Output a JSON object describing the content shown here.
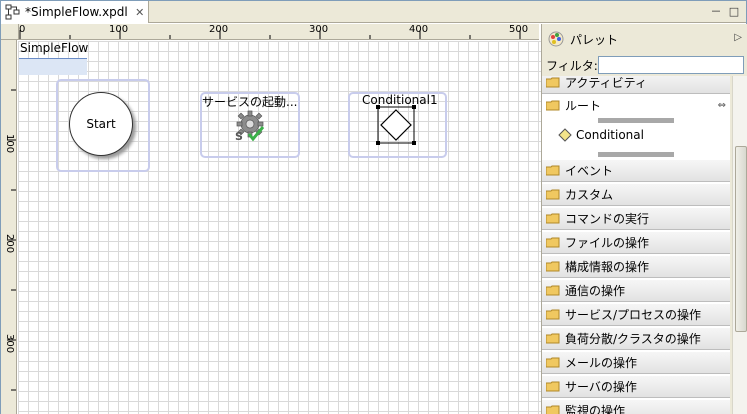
{
  "tab": {
    "title": "*SimpleFlow.xpdl",
    "close_icon": "close-icon"
  },
  "window_controls": {
    "minimize": "－",
    "maximize": "□"
  },
  "ruler": {
    "top_labels": [
      "0",
      "100",
      "200",
      "300",
      "400",
      "500"
    ],
    "left_labels": [
      "100",
      "200",
      "300"
    ]
  },
  "canvas": {
    "pool_name": "SimpleFlow",
    "nodes": {
      "start": {
        "label": "Start"
      },
      "service": {
        "label": "サービスの起動..."
      },
      "conditional": {
        "label": "Conditional1"
      }
    }
  },
  "palette": {
    "title": "パレット",
    "filter_label": "フィルタ:",
    "filter_value": "",
    "items": [
      {
        "label": "アクティビティ"
      },
      {
        "label": "ルート"
      },
      {
        "label": "Conditional"
      },
      {
        "label": "イベント"
      },
      {
        "label": "カスタム"
      },
      {
        "label": "コマンドの実行"
      },
      {
        "label": "ファイルの操作"
      },
      {
        "label": "構成情報の操作"
      },
      {
        "label": "通信の操作"
      },
      {
        "label": "サービス/プロセスの操作"
      },
      {
        "label": "負荷分散/クラスタの操作"
      },
      {
        "label": "メールの操作"
      },
      {
        "label": "サーバの操作"
      },
      {
        "label": "監視の操作"
      }
    ]
  },
  "colors": {
    "node_border": "#c8ccec",
    "accent": "#6a8cc7",
    "check_green": "#3cb04a"
  }
}
